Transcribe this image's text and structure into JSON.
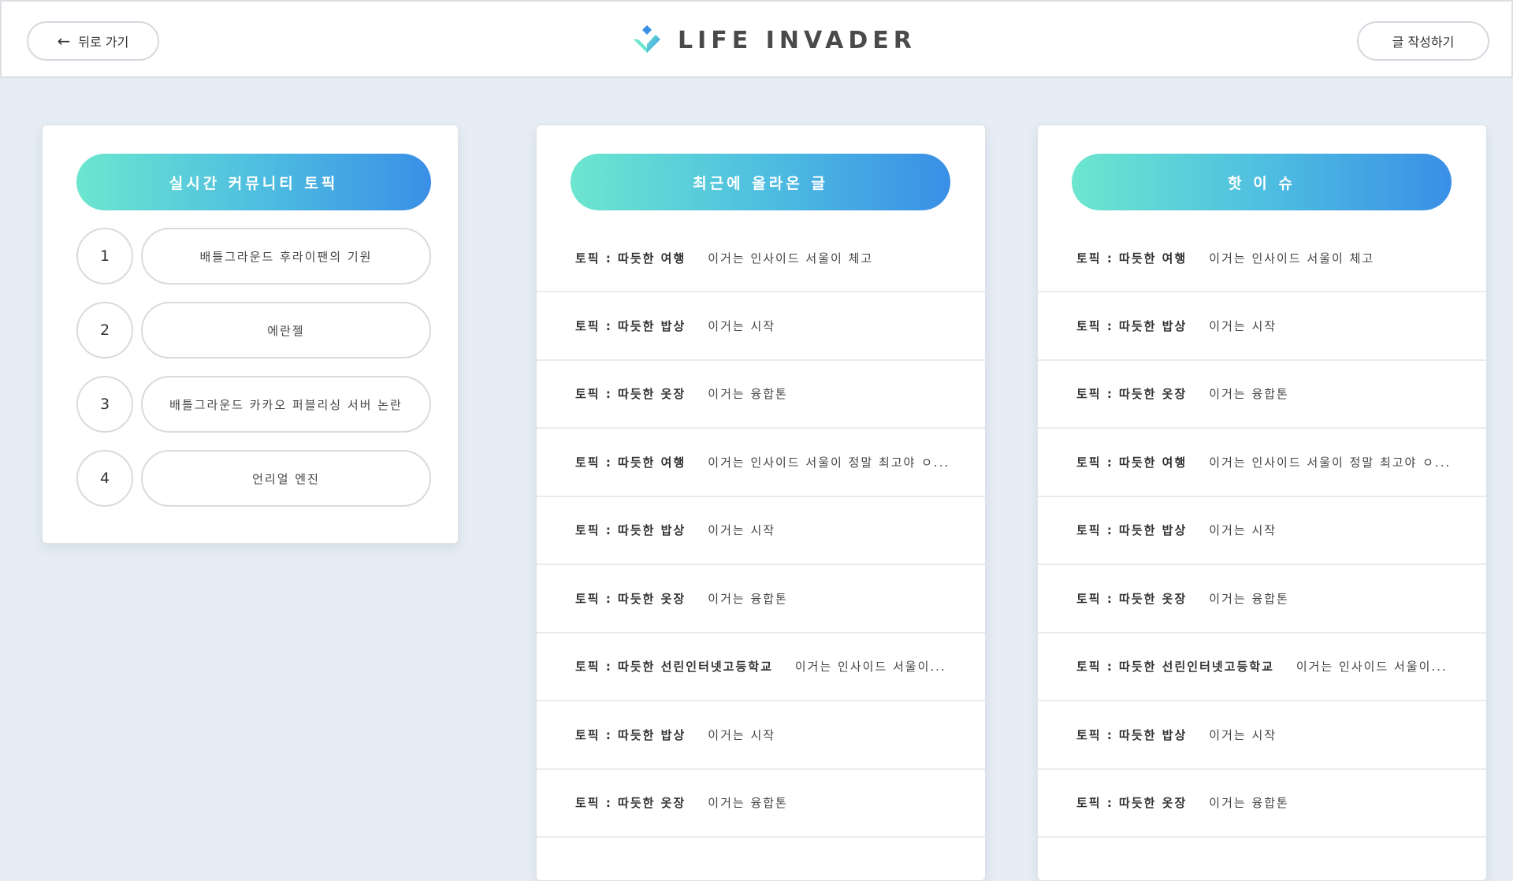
{
  "header": {
    "back_label": "뒤로 가기",
    "logo_text": "LIFE INVADER",
    "write_label": "글 작성하기"
  },
  "colors": {
    "background": "#e6edf4",
    "gradient_start": "#6ce6cf",
    "gradient_end": "#3a8fe6"
  },
  "topics": {
    "title": "실시간 커뮤니티 토픽",
    "items": [
      {
        "rank": "1",
        "label": "배틀그라운드 후라이팬의 기원"
      },
      {
        "rank": "2",
        "label": "에란젤"
      },
      {
        "rank": "3",
        "label": "배틀그라운드 카카오 퍼블리싱 서버 논란"
      },
      {
        "rank": "4",
        "label": "언리얼 엔진"
      }
    ]
  },
  "recent": {
    "title": "최근에 올라온 글",
    "posts": [
      {
        "topic": "토픽 : 따듯한 여행",
        "text": "이거는 인사이드 서울이 체고"
      },
      {
        "topic": "토픽 : 따듯한 밥상",
        "text": "이거는 시작"
      },
      {
        "topic": "토픽 : 따듯한 옷장",
        "text": "이거는 융합톤"
      },
      {
        "topic": "토픽 : 따듯한 여행",
        "text": "이거는 인사이드 서울이 정말 최고야 ㅇ..."
      },
      {
        "topic": "토픽 : 따듯한 밥상",
        "text": "이거는 시작"
      },
      {
        "topic": "토픽 : 따듯한 옷장",
        "text": "이거는 융합톤"
      },
      {
        "topic": "토픽 : 따듯한 선린인터넷고등학교",
        "text": "이거는 인사이드 서울이..."
      },
      {
        "topic": "토픽 : 따듯한 밥상",
        "text": "이거는 시작"
      },
      {
        "topic": "토픽 : 따듯한 옷장",
        "text": "이거는 융합톤"
      }
    ]
  },
  "hot": {
    "title": "핫 이 슈",
    "posts": [
      {
        "topic": "토픽 : 따듯한 여행",
        "text": "이거는 인사이드 서울이 체고"
      },
      {
        "topic": "토픽 : 따듯한 밥상",
        "text": "이거는 시작"
      },
      {
        "topic": "토픽 : 따듯한 옷장",
        "text": "이거는 융합톤"
      },
      {
        "topic": "토픽 : 따듯한 여행",
        "text": "이거는 인사이드 서울이 정말 최고야 ㅇ..."
      },
      {
        "topic": "토픽 : 따듯한 밥상",
        "text": "이거는 시작"
      },
      {
        "topic": "토픽 : 따듯한 옷장",
        "text": "이거는 융합톤"
      },
      {
        "topic": "토픽 : 따듯한 선린인터넷고등학교",
        "text": "이거는 인사이드 서울이..."
      },
      {
        "topic": "토픽 : 따듯한 밥상",
        "text": "이거는 시작"
      },
      {
        "topic": "토픽 : 따듯한 옷장",
        "text": "이거는 융합톤"
      }
    ]
  }
}
